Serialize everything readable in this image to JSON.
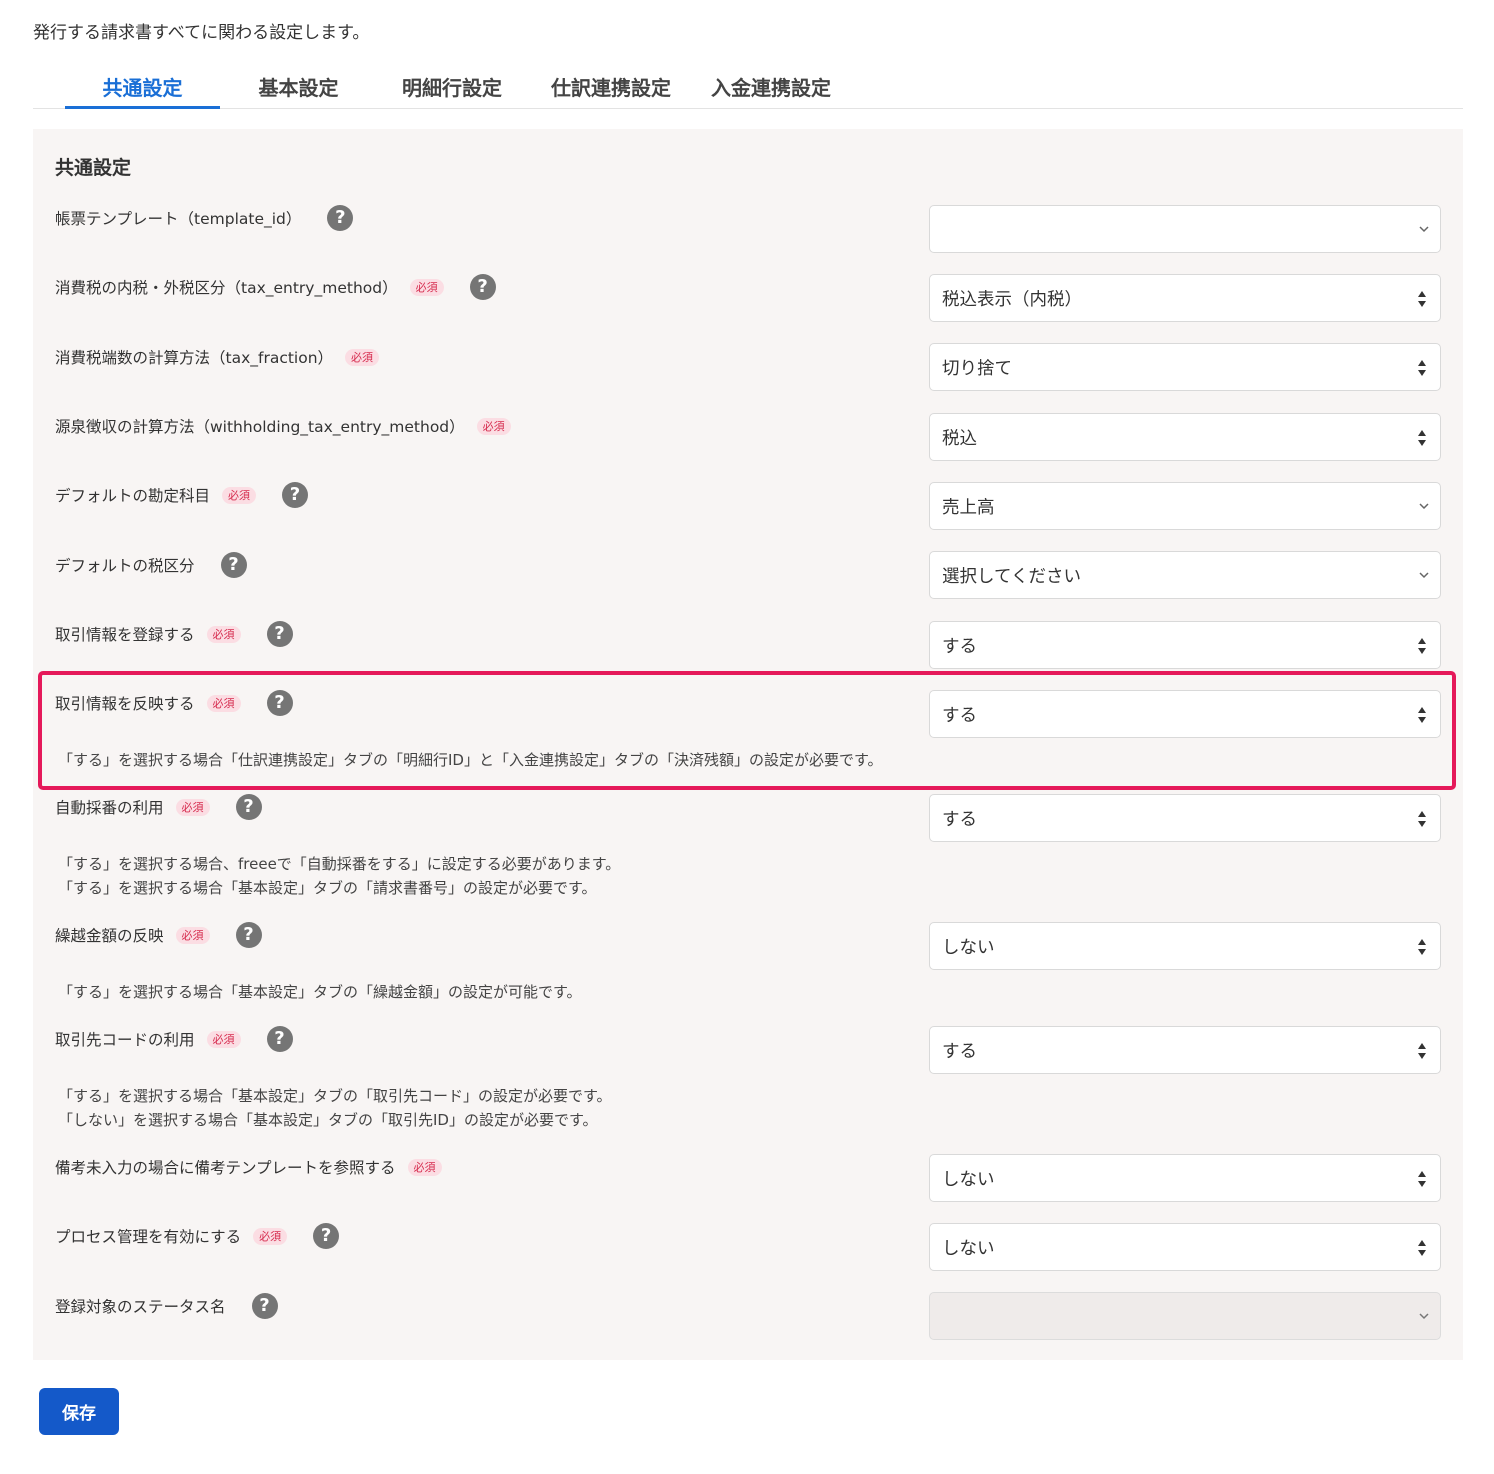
{
  "intro_text": "発行する請求書すべてに関わる設定します。",
  "tabs": [
    {
      "label": "共通設定",
      "active": true
    },
    {
      "label": "基本設定",
      "active": false
    },
    {
      "label": "明細行設定",
      "active": false
    },
    {
      "label": "仕訳連携設定",
      "active": false
    },
    {
      "label": "入金連携設定",
      "active": false
    }
  ],
  "panel_title": "共通設定",
  "required_label": "必須",
  "help_glyph": "?",
  "fields": [
    {
      "label": "帳票テンプレート（template_id）",
      "value": "",
      "required": false,
      "help": true
    },
    {
      "label": "消費税の内税・外税区分（tax_entry_method）",
      "value": "税込表示（内税）",
      "required": true,
      "help": true
    },
    {
      "label": "消費税端数の計算方法（tax_fraction）",
      "value": "切り捨て",
      "required": true,
      "help": false
    },
    {
      "label": "源泉徴収の計算方法（withholding_tax_entry_method）",
      "value": "税込",
      "required": true,
      "help": false
    },
    {
      "label": "デフォルトの勘定科目",
      "value": "売上高",
      "required": true,
      "help": true
    },
    {
      "label": "デフォルトの税区分",
      "value": "選択してください",
      "required": false,
      "help": true
    },
    {
      "label": "取引情報を登録する",
      "value": "する",
      "required": true,
      "help": true
    },
    {
      "label": "取引情報を反映する",
      "value": "する",
      "required": true,
      "help": true,
      "notes": [
        "「する」を選択する場合「仕訳連携設定」タブの「明細行ID」と「入金連携設定」タブの「決済残額」の設定が必要です。"
      ]
    },
    {
      "label": "自動採番の利用",
      "value": "する",
      "required": true,
      "help": true,
      "notes": [
        "「する」を選択する場合、freeeで「自動採番をする」に設定する必要があります。",
        "「する」を選択する場合「基本設定」タブの「請求書番号」の設定が必要です。"
      ]
    },
    {
      "label": "繰越金額の反映",
      "value": "しない",
      "required": true,
      "help": true,
      "notes": [
        "「する」を選択する場合「基本設定」タブの「繰越金額」の設定が可能です。"
      ]
    },
    {
      "label": "取引先コードの利用",
      "value": "する",
      "required": true,
      "help": true,
      "notes": [
        "「する」を選択する場合「基本設定」タブの「取引先コード」の設定が必要です。",
        "「しない」を選択する場合「基本設定」タブの「取引先ID」の設定が必要です。"
      ]
    },
    {
      "label": "備考未入力の場合に備考テンプレートを参照する",
      "value": "しない",
      "required": true,
      "help": false
    },
    {
      "label": "プロセス管理を有効にする",
      "value": "しない",
      "required": true,
      "help": true
    },
    {
      "label": "登録対象のステータス名",
      "value": "",
      "required": false,
      "help": true,
      "disabled": true
    }
  ],
  "save_label": "保存",
  "colors": {
    "accent": "#1a6fd6",
    "save_button": "#1459c9",
    "highlight": "#e5195a",
    "required": "#d62c4f",
    "panel_bg": "#f8f5f4"
  }
}
